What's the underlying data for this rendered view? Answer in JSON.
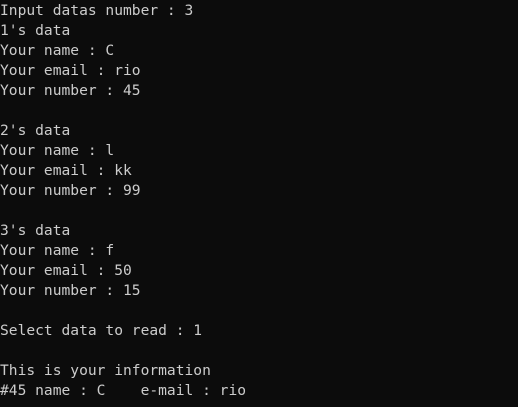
{
  "console": {
    "lines": [
      "Input datas number : 3",
      "1's data",
      "Your name : C",
      "Your email : rio",
      "Your number : 45",
      "",
      "2's data",
      "Your name : l",
      "Your email : kk",
      "Your number : 99",
      "",
      "3's data",
      "Your name : f",
      "Your email : 50",
      "Your number : 15",
      "",
      "Select data to read : 1",
      "",
      "This is your information",
      "#45 name : C    e-mail : rio"
    ]
  }
}
